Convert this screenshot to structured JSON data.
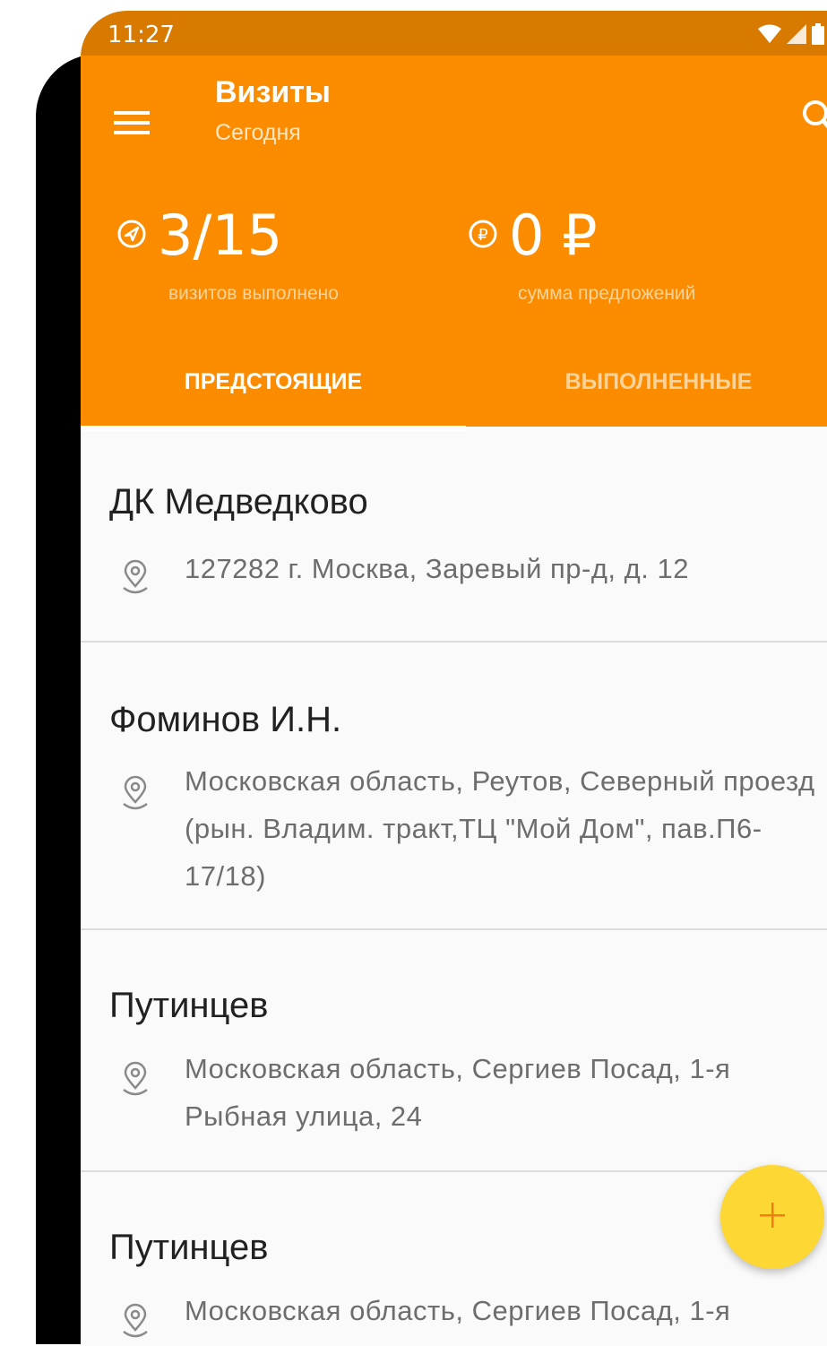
{
  "status_bar": {
    "time": "11:27",
    "wifi_icon": "wifi-icon",
    "signal_icon": "signal-icon",
    "battery_icon": "battery-icon"
  },
  "app_bar": {
    "title": "Визиты",
    "subtitle": "Сегодня",
    "menu_icon": "menu-icon",
    "search_icon": "search-icon",
    "background_color": "#fb8c00"
  },
  "stats": {
    "visits": {
      "value": "3/15",
      "label": "визитов выполнено",
      "icon": "navigation-arrow-icon"
    },
    "offers": {
      "value": "0 ₽",
      "label": "сумма предложений",
      "icon": "ruble-coin-icon"
    }
  },
  "tabs": [
    {
      "label": "ПРЕДСТОЯЩИЕ",
      "active": true
    },
    {
      "label": "ВЫПОЛНЕННЫЕ",
      "active": false
    }
  ],
  "visits": [
    {
      "name": "ДК Медведково",
      "address": "127282 г. Москва, Заревый пр-д, д. 12"
    },
    {
      "name": "Фоминов И.Н.",
      "address": "Московская область, Реутов, Северный проезд (рын. Владим. тракт,ТЦ \"Мой Дом\", пав.П6-17/18)"
    },
    {
      "name": "Путинцев",
      "address": "Московская область, Сергиев Посад, 1-я Рыбная улица, 24"
    },
    {
      "name": "Путинцев",
      "address": "Московская область, Сергиев Посад, 1-я"
    }
  ],
  "fab": {
    "icon": "plus-icon",
    "color": "#fdd835"
  }
}
